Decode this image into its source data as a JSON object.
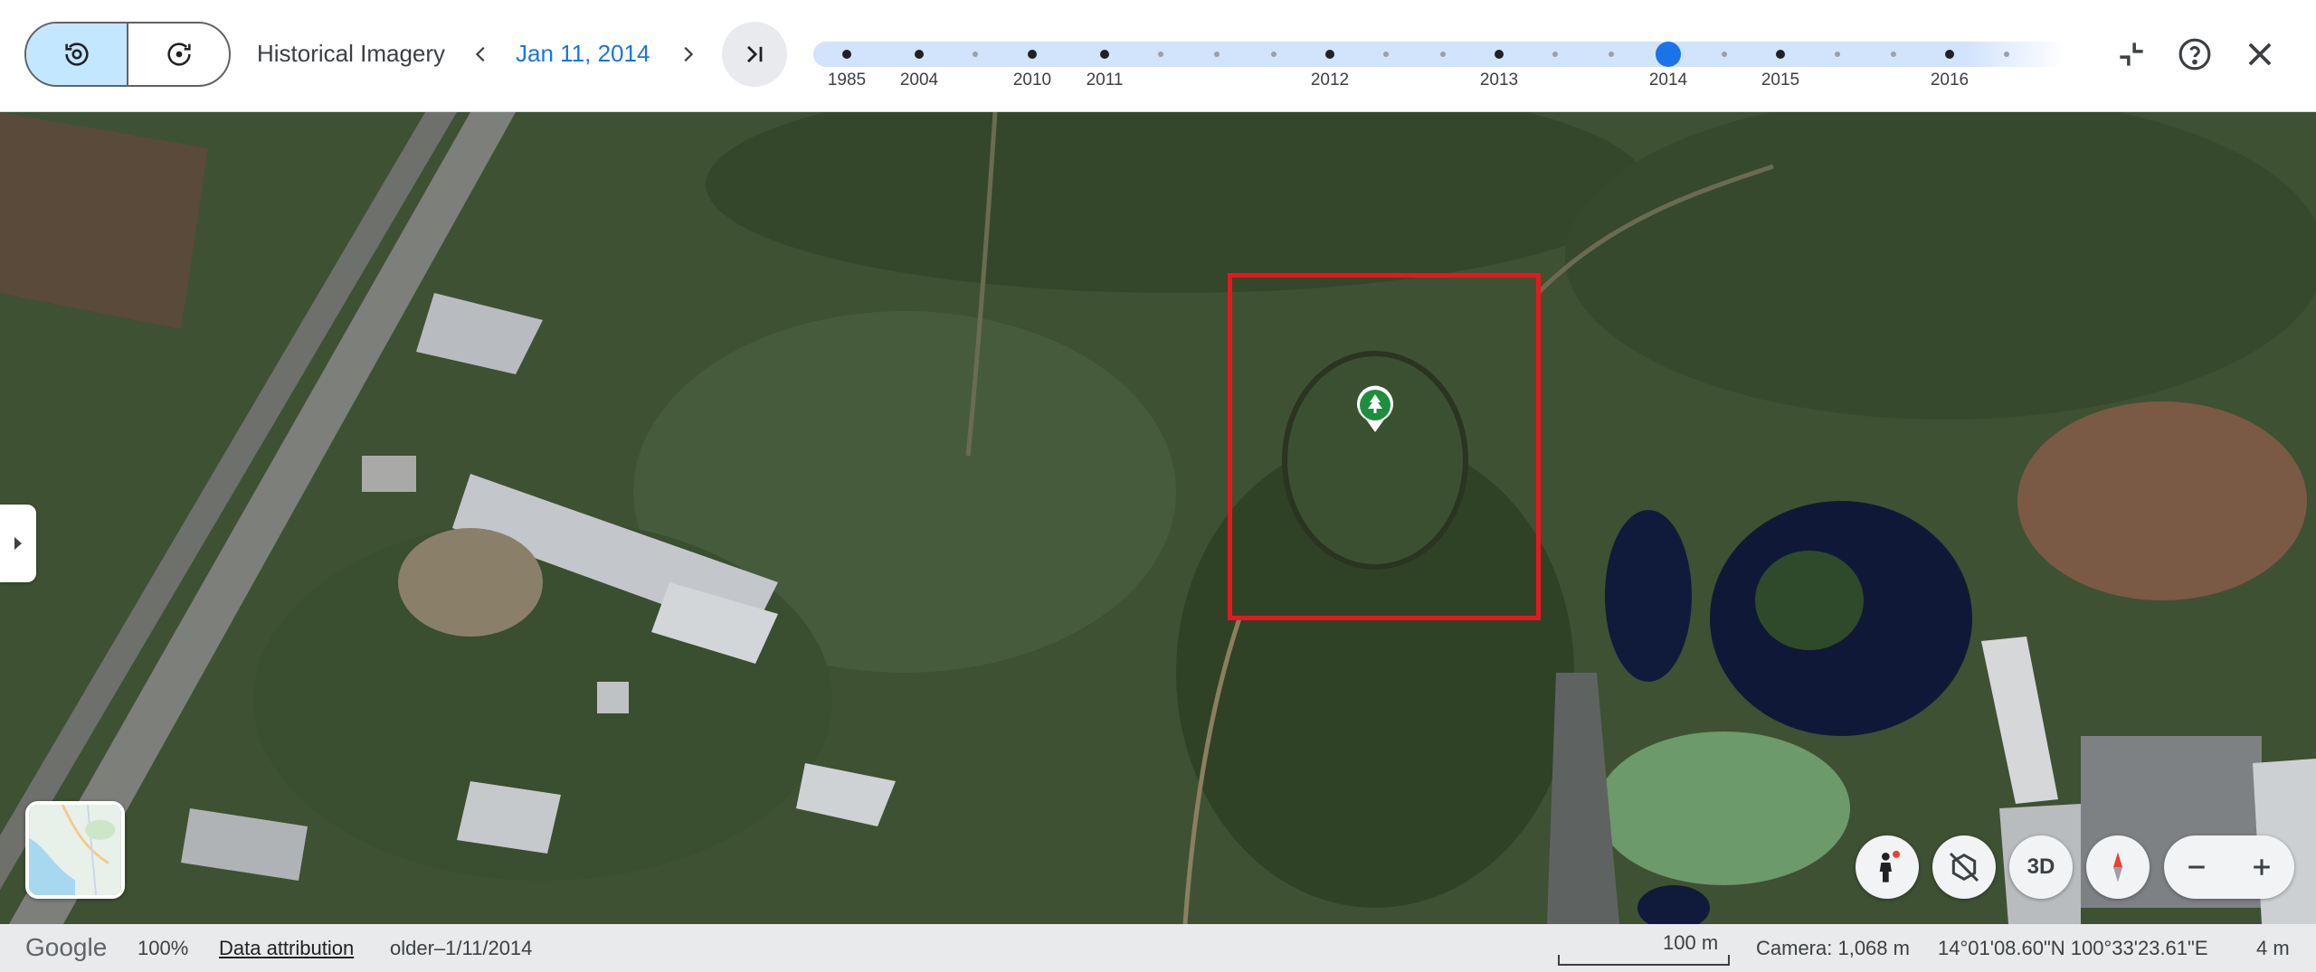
{
  "toolbar": {
    "title": "Historical Imagery",
    "date": "Jan 11, 2014",
    "history_icon": "history-icon",
    "refresh_icon": "refresh-icon",
    "prev_icon": "chevron-left-icon",
    "next_icon": "chevron-right-icon",
    "jump_latest_icon": "skip-to-latest-icon",
    "collapse_icon": "collapse-icon",
    "help_icon": "help-icon",
    "close_icon": "close-icon"
  },
  "timeline": {
    "labels": [
      "1985",
      "2004",
      "2010",
      "2011",
      "2012",
      "2013",
      "2014",
      "2015",
      "2016"
    ],
    "selected": "2014",
    "accent": "#1a73e8"
  },
  "map": {
    "layer_icon": "minimap-thumbnail",
    "pin_icon": "tree-pin-icon",
    "side_toggle_icon": "expand-panel-icon",
    "controls": {
      "street_view_icon": "pegman-icon",
      "tilt_icon": "tilt-off-icon",
      "mode_3d": "3D",
      "compass_icon": "compass-icon",
      "zoom_out_icon": "minus-icon",
      "zoom_in_icon": "plus-icon"
    },
    "selection_color": "#e8171c"
  },
  "status_bar": {
    "brand": "Google",
    "zoom": "100%",
    "data_attribution": "Data attribution",
    "imagery_date": "older–1/11/2014",
    "scale": "100 m",
    "camera": "Camera: 1,068 m",
    "coordinates": "14°01'08.60\"N 100°33'23.61\"E",
    "elevation": "4 m"
  }
}
